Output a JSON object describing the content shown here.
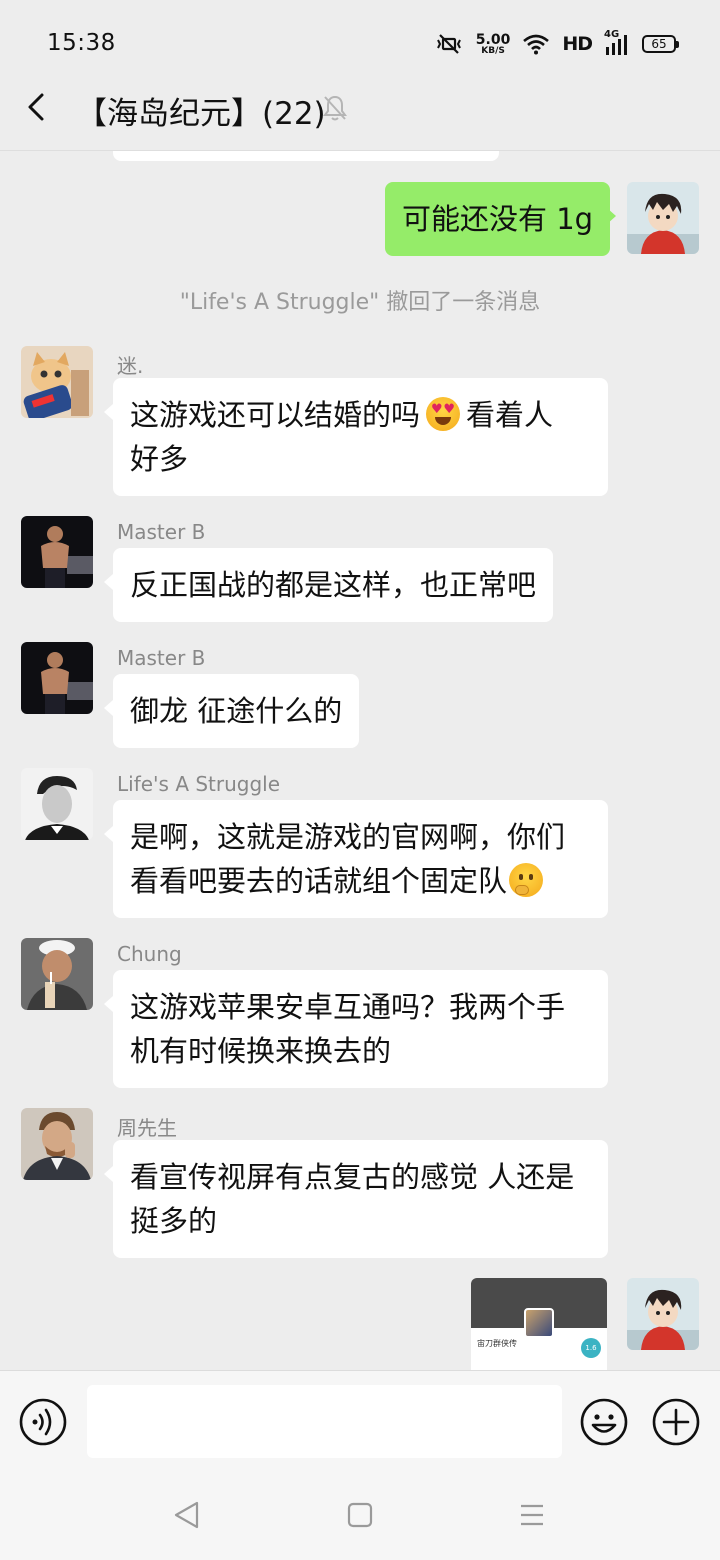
{
  "status_bar": {
    "time": "15:38",
    "net_speed_value": "5.00",
    "net_speed_unit": "KB/S",
    "hd_label": "HD",
    "network_label": "4G",
    "battery_level": "65"
  },
  "header": {
    "title": "【海岛纪元】(22)"
  },
  "messages": [
    {
      "id": "m0",
      "from": "me",
      "text": "可能还没有 1g"
    },
    {
      "id": "sys",
      "type": "system",
      "text": "\"Life's A Struggle\" 撤回了一条消息"
    },
    {
      "id": "m1",
      "sender": "迷.",
      "text_a": "这游戏还可以结婚的吗",
      "text_b": "看着人",
      "text_c": "好多"
    },
    {
      "id": "m2",
      "sender": "Master B",
      "text": "反正国战的都是这样，也正常吧"
    },
    {
      "id": "m3",
      "sender": "Master B",
      "text": "御龙 征途什么的"
    },
    {
      "id": "m4",
      "sender": "Life's A Struggle",
      "line1": "是啊，这就是游戏的官网啊，你们",
      "line2": "看看吧要去的话就组个固定队"
    },
    {
      "id": "m5",
      "sender": "Chung",
      "line1": "这游戏苹果安卓互通吗？我两个手",
      "line2": "机有时候换来换去的"
    },
    {
      "id": "m6",
      "sender": "周先生",
      "line1": "看宣传视屏有点复古的感觉 人还是",
      "line2": "挺多的"
    },
    {
      "id": "m7",
      "from": "me",
      "type": "image",
      "thumb_title": "宙刀群侠传",
      "thumb_badge": "1.6"
    }
  ],
  "input": {
    "placeholder": ""
  },
  "colors": {
    "background": "#ededed",
    "my_bubble": "#95ec69",
    "other_bubble": "#ffffff",
    "system_text": "#9a9a9a",
    "sender_text": "#888888"
  }
}
